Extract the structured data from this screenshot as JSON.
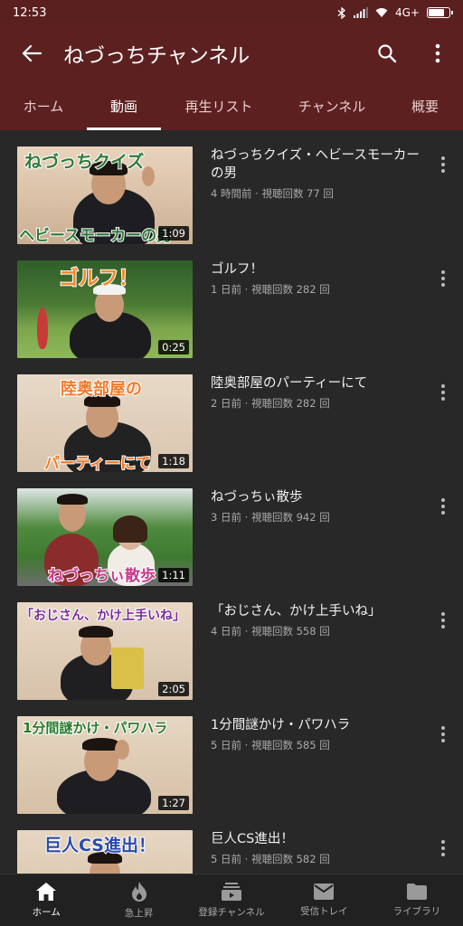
{
  "status": {
    "time": "12:53",
    "network": "4G+"
  },
  "appbar": {
    "title": "ねづっちチャンネル"
  },
  "tabs": [
    "ホーム",
    "動画",
    "再生リスト",
    "チャンネル",
    "概要"
  ],
  "active_tab": 1,
  "videos": [
    {
      "title": "ねづっちクイズ・ヘビースモーカーの男",
      "info": "4 時間前 · 視聴回数 77 回",
      "duration": "1:09",
      "caption_top": "ねづっちクイズ",
      "caption_bottom": "ヘビースモーカーの男"
    },
    {
      "title": "ゴルフ！",
      "info": "1 日前 · 視聴回数 282 回",
      "duration": "0:25",
      "caption_top": "ゴルフ！",
      "caption_bottom": ""
    },
    {
      "title": "陸奥部屋のパーティーにて",
      "info": "2 日前 · 視聴回数 282 回",
      "duration": "1:18",
      "caption_top": "陸奥部屋の",
      "caption_bottom": "パーティーにて"
    },
    {
      "title": "ねづっちぃ散歩",
      "info": "3 日前 · 視聴回数 942 回",
      "duration": "1:11",
      "caption_top": "",
      "caption_bottom": "ねづっちぃ散歩"
    },
    {
      "title": "「おじさん、かけ上手いね」",
      "info": "4 日前 · 視聴回数 558 回",
      "duration": "2:05",
      "caption_top": "「おじさん、かけ上手いね」",
      "caption_bottom": ""
    },
    {
      "title": "1分間謎かけ・パワハラ",
      "info": "5 日前 · 視聴回数 585 回",
      "duration": "1:27",
      "caption_top": "1分間謎かけ・パワハラ",
      "caption_bottom": ""
    },
    {
      "title": "巨人CS進出！",
      "info": "5 日前 · 視聴回数 582 回",
      "duration": "",
      "caption_top": "巨人CS進出！",
      "caption_bottom": ""
    }
  ],
  "bottom_nav": [
    {
      "label": "ホーム",
      "icon": "home-icon"
    },
    {
      "label": "急上昇",
      "icon": "trending-flame-icon"
    },
    {
      "label": "登録チャンネル",
      "icon": "subscriptions-icon"
    },
    {
      "label": "受信トレイ",
      "icon": "inbox-mail-icon"
    },
    {
      "label": "ライブラリ",
      "icon": "library-folder-icon"
    }
  ],
  "colors": {
    "header": "#5d2020",
    "background": "#282828"
  }
}
